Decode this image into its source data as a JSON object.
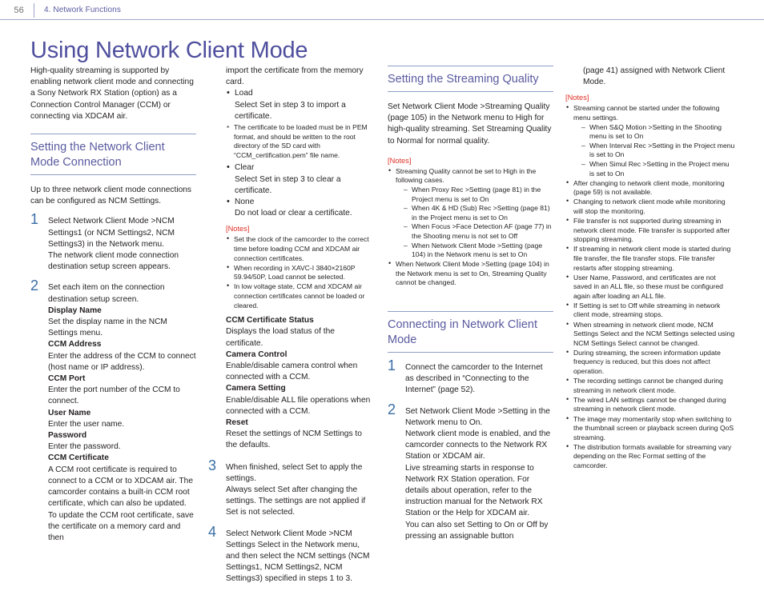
{
  "header": {
    "folio": "56",
    "chapter": "4. Network Functions"
  },
  "title": "Using Network Client Mode",
  "col1": {
    "intro": "High-quality streaming is supported by enabling network client mode and connecting a Sony Network RX Station (option) as a Connection Control Manager (CCM) or connecting via XDCAM air.",
    "section_heading": "Setting the Network Client Mode Connection",
    "lead": "Up to three network client mode connections can be configured as NCM Settings.",
    "step1_num": "1",
    "step1_text": "Select Network Client Mode >NCM Settings1 (or NCM Settings2, NCM Settings3) in the Network menu.",
    "step1_text2": "The network client mode connection destination setup screen appears.",
    "step2_num": "2",
    "step2_text": "Set each item on the connection destination setup screen.",
    "terms": [
      {
        "term": "Display Name",
        "def": "Set the display name in the NCM Settings menu."
      },
      {
        "term": "CCM Address",
        "def": "Enter the address of the CCM to connect (host name or IP address)."
      },
      {
        "term": "CCM Port",
        "def": "Enter the port number of the CCM to connect."
      },
      {
        "term": "User Name",
        "def": "Enter the user name."
      },
      {
        "term": "Password",
        "def": "Enter the password."
      },
      {
        "term": "CCM Certificate",
        "def": "A CCM root certificate is required to connect to a CCM or to XDCAM air. The camcorder contains a built-in CCM root certificate, which can also be updated. To update the CCM root certificate, save the certificate on a memory card and then"
      }
    ]
  },
  "col2": {
    "cont_text": "import the certificate from the memory card.",
    "bullets": [
      {
        "label": "Load",
        "text": "Select Set in step 3 to import a certificate."
      },
      {
        "label": "Clear",
        "text": "Select Set in step 3 to clear a certificate."
      },
      {
        "label": "None",
        "text": "Do not load or clear a certificate."
      }
    ],
    "asterisk_note": "The certificate to be loaded must be in PEM format, and should be written to the root directory of the SD card with “CCM_certification.pem” file name.",
    "notes_label": "[Notes]",
    "notes": [
      "Set the clock of the camcorder to the correct time before loading CCM and XDCAM air connection certificates.",
      "When recording in XAVC-I 3840×2160P 59.94/50P, Load cannot be selected.",
      "In low voltage state, CCM and XDCAM air connection certificates cannot be loaded or cleared."
    ],
    "terms": [
      {
        "term": "CCM Certificate Status",
        "def": "Displays the load status of the certificate."
      },
      {
        "term": "Camera Control",
        "def": "Enable/disable camera control when connected with a CCM."
      },
      {
        "term": "Camera Setting",
        "def": "Enable/disable ALL file operations when connected with a CCM."
      },
      {
        "term": "Reset",
        "def": "Reset the settings of NCM Settings to the defaults."
      }
    ],
    "step3_num": "3",
    "step3_text": "When finished, select Set to apply the settings.",
    "step3_text2": "Always select Set after changing the settings. The settings are not applied if Set is not selected.",
    "step4_num": "4",
    "step4_text": "Select Network Client Mode >NCM Settings Select in the Network menu, and then select the NCM settings (NCM Settings1, NCM Settings2, NCM Settings3) specified in steps 1 to 3."
  },
  "col3": {
    "section_heading": "Setting the Streaming Quality",
    "body": "Set Network Client Mode >Streaming Quality (page 105) in the Network menu to High for high-quality streaming. Set Streaming Quality to Normal for normal quality.",
    "notes_label": "[Notes]",
    "note1": "Streaming Quality cannot be set to High in the following cases.",
    "note1_subs": [
      "When Proxy Rec >Setting (page 81) in the Project menu is set to On",
      "When 4K & HD (Sub) Rec >Setting (page 81) in the Project menu is set to On",
      "When Focus >Face Detection AF (page 77) in the Shooting menu is not set to Off",
      "When Network Client Mode >Setting (page 104) in the Network menu is set to On"
    ],
    "note2": "When Network Client Mode >Setting (page 104) in the Network menu is set to On, Streaming Quality cannot be changed.",
    "section_heading2": "Connecting in Network Client Mode",
    "step1_num": "1",
    "step1_text": "Connect the camcorder to the Internet as described in “Connecting to the Internet” (page 52).",
    "step2_num": "2",
    "step2_text": "Set Network Client Mode >Setting in the Network menu to On.",
    "step2_text2": "Network client mode is enabled, and the camcorder connects to the Network RX Station or XDCAM air.",
    "step2_text3": "Live streaming starts in response to Network RX Station operation. For details about operation, refer to the instruction manual for the Network RX Station or the Help for XDCAM air.",
    "step2_text4": "You can also set Setting to On or Off by pressing an assignable button"
  },
  "col4": {
    "cont_text": "(page 41) assigned with Network Client Mode.",
    "notes_label": "[Notes]",
    "note1": "Streaming cannot be started under the following menu settings.",
    "note1_subs": [
      "When S&Q Motion >Setting in the Shooting menu is set to On",
      "When Interval Rec >Setting in the Project menu is set to On",
      "When Simul Rec >Setting in the Project menu is set to On"
    ],
    "notes": [
      "After changing to network client mode, monitoring (page 59) is not available.",
      "Changing to network client mode while monitoring will stop the monitoring.",
      "File transfer is not supported during streaming in network client mode. File transfer is supported after stopping streaming.",
      "If streaming in network client mode is started during file transfer, the file transfer stops. File transfer restarts after stopping streaming.",
      "User Name, Password, and certificates are not saved in an ALL file, so these must be configured again after loading an ALL file.",
      "If Setting is set to Off while streaming in network client mode, streaming stops.",
      "When streaming in network client mode, NCM Settings Select and the NCM Settings selected using NCM Settings Select cannot be changed.",
      "During streaming, the screen information update frequency is reduced, but this does not affect operation.",
      "The recording settings cannot be changed during streaming in network client mode.",
      "The wired LAN settings cannot be changed during streaming in network client mode.",
      "The image may momentarily stop when switching to the thumbnail screen or playback screen during QoS streaming.",
      "The distribution formats available for streaming vary depending on the Rec Format setting of the camcorder."
    ]
  },
  "colors": {
    "title": "#4f4f9e",
    "heading": "#5a5ba0",
    "step_number": "#3a6ea5",
    "notes_label": "#e03127",
    "rule": "#8fa0c4",
    "body_text": "#231f20"
  }
}
